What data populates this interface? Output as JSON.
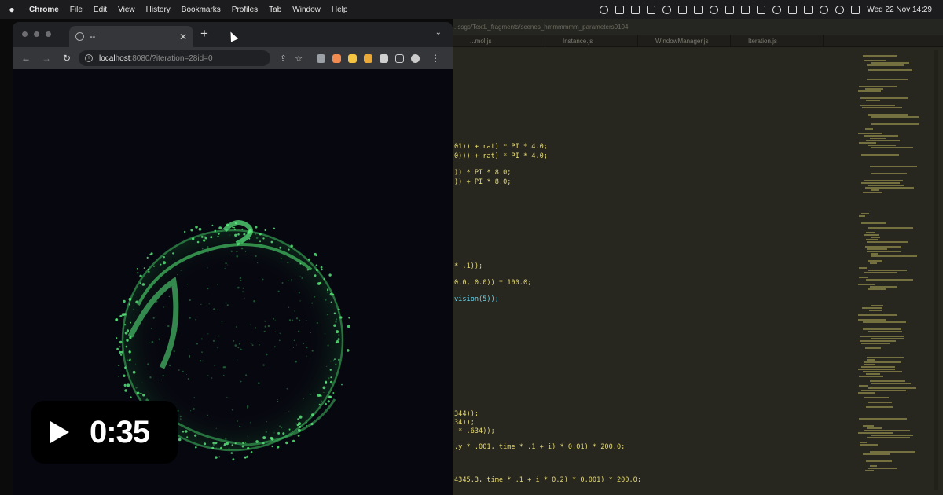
{
  "menubar": {
    "app_name": "Chrome",
    "menus": [
      "File",
      "Edit",
      "View",
      "History",
      "Bookmarks",
      "Profiles",
      "Tab",
      "Window",
      "Help"
    ],
    "clock": "Wed 22 Nov  14:29"
  },
  "browser": {
    "tab_title": "--",
    "url_host": "localhost",
    "url_rest": ":8080/?iteration=28id=0",
    "extension_colors": [
      "#9aa0a6",
      "#f28b50",
      "#f5c542",
      "#e8a83a",
      "#cfcfcf"
    ]
  },
  "editor": {
    "path": "..ssgs/TextL_fragments/scenes_hmmmmmm_parameters0104",
    "tabs": [
      "...mol.js",
      "Instance.js",
      "WindowManager.js",
      "Iteration.js"
    ],
    "code_lines": [
      {
        "text": "01)) + rat) * PI * 4.0;",
        "kind": "plain"
      },
      {
        "text": "0))) + rat) * PI * 4.0;",
        "kind": "plain"
      },
      {
        "text": ")) * PI * 8.0;",
        "kind": "plain"
      },
      {
        "text": ")) + PI * 8.0;",
        "kind": "plain"
      },
      {
        "text": "* .1));",
        "kind": "plain"
      },
      {
        "text": "0.0, 0.0)) * 100.0;",
        "kind": "plain"
      },
      {
        "text": "vision(5));",
        "kind": "fn"
      },
      {
        "text": "344));",
        "kind": "plain"
      },
      {
        "text": "34));",
        "kind": "plain"
      },
      {
        "text": " * .634));",
        "kind": "plain"
      },
      {
        "text": ".y * .001, time * .1 + i) * 0.01) * 200.0;",
        "kind": "plain"
      },
      {
        "text": "4345.3, time * .1 + i * 0.2) * 0.001) * 200.0;",
        "kind": "plain"
      }
    ]
  },
  "video": {
    "duration": "0:35"
  }
}
